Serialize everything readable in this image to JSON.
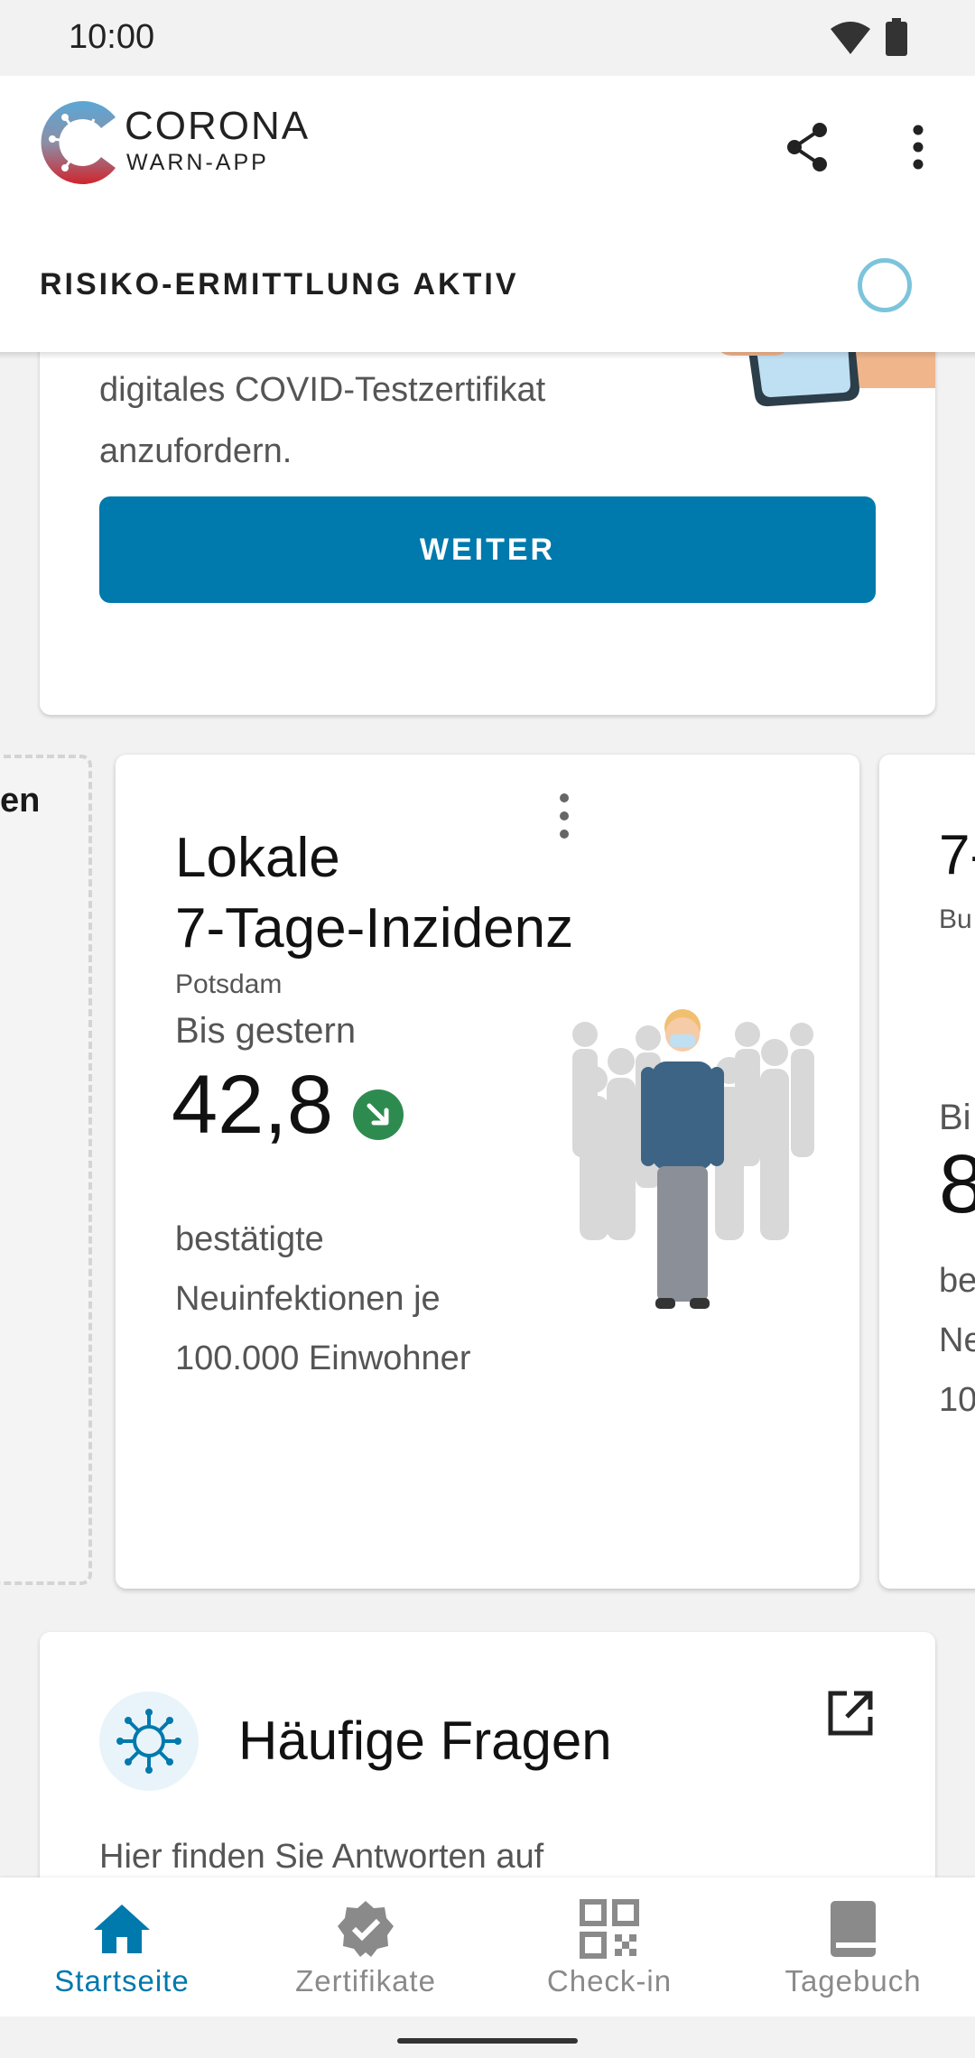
{
  "status_bar": {
    "time": "10:00",
    "icons": [
      "wifi-icon",
      "battery-icon"
    ]
  },
  "header": {
    "logo_title": "CORONA",
    "logo_subtitle": "WARN-APP",
    "actions": [
      "share-icon",
      "more-vert-icon"
    ],
    "risk_status": "RISIKO-ERMITTLUNG AKTIV"
  },
  "cert_card": {
    "text": "digitales COVID-Testzertifikat anzufordern.",
    "button_label": "WEITER"
  },
  "stats": {
    "left_partial_text": "en",
    "incidence": {
      "title_line1": "Lokale",
      "title_line2": "7-Tage-Inzidenz",
      "location": "Potsdam",
      "period": "Bis gestern",
      "value": "42,8",
      "trend": "decreasing",
      "description": "bestätigte Neuinfektionen je 100.000 Einwohner"
    },
    "right_partial": {
      "title": "7-",
      "subtitle": "Bu",
      "period": "Bi",
      "value": "8",
      "desc_lines": [
        "be",
        "Ne",
        "10"
      ]
    }
  },
  "faq": {
    "title": "Häufige Fragen",
    "text": "Hier finden Sie Antworten auf"
  },
  "bottom_nav": {
    "items": [
      {
        "label": "Startseite",
        "icon": "home-icon",
        "active": true
      },
      {
        "label": "Zertifikate",
        "icon": "certificate-badge-icon",
        "active": false
      },
      {
        "label": "Check-in",
        "icon": "qr-code-icon",
        "active": false
      },
      {
        "label": "Tagebuch",
        "icon": "book-icon",
        "active": false
      }
    ]
  },
  "colors": {
    "accent": "#0079ad",
    "trend_green": "#2e8b4f",
    "risk_ring": "#7cc4db",
    "nav_inactive": "#8a8a8a"
  }
}
